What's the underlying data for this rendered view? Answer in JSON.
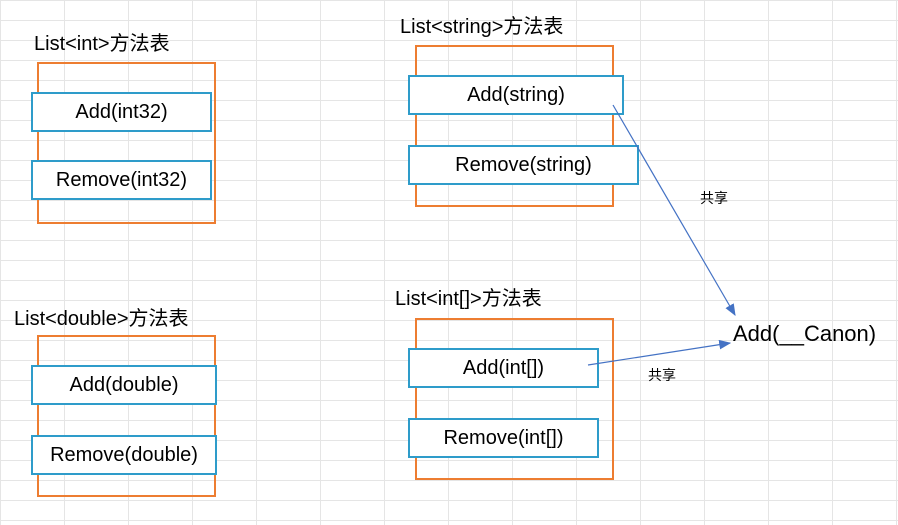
{
  "titles": {
    "int": "List<int>方法表",
    "double": "List<double>方法表",
    "string": "List<string>方法表",
    "intarr": "List<int[]>方法表"
  },
  "methods": {
    "int": {
      "add": "Add(int32)",
      "remove": "Remove(int32)"
    },
    "double": {
      "add": "Add(double)",
      "remove": "Remove(double)"
    },
    "string": {
      "add": "Add(string)",
      "remove": "Remove(string)"
    },
    "intarr": {
      "add": "Add(int[])",
      "remove": "Remove(int[])"
    }
  },
  "share_label_top": "共享",
  "share_label_bottom": "共享",
  "target": "Add(__Canon)",
  "colors": {
    "box_border": "#ed7d31",
    "method_border": "#2e9cca",
    "arrow": "#4472c4"
  }
}
